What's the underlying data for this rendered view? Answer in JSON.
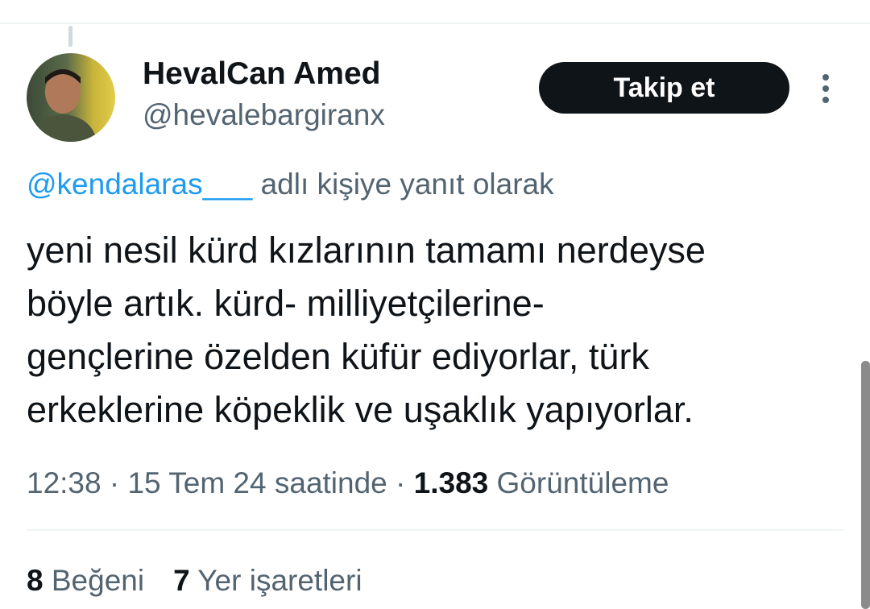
{
  "author": {
    "display_name": "HevalCan Amed",
    "handle": "@hevalebargiranx",
    "avatar_icon": "user-avatar"
  },
  "follow_button": {
    "label": "Takip et"
  },
  "more_icon": "more-vertical-icon",
  "reply": {
    "mention": "@kendalaras___",
    "suffix": " adlı kişiye yanıt olarak"
  },
  "tweet": {
    "lines": [
      "yeni nesil kürd kızlarının tamamı nerdeyse",
      "böyle artık. kürd- milliyetçilerine-",
      "gençlerine özelden küfür ediyorlar, türk",
      "erkeklerine köpeklik ve uşaklık yapıyorlar."
    ]
  },
  "meta": {
    "time": "12:38",
    "separator": " · ",
    "date": "15 Tem 24 saatinde",
    "views_count": "1.383",
    "views_label": " Görüntüleme"
  },
  "stats": {
    "likes_count": "8",
    "likes_label": " Beğeni",
    "bookmarks_count": "7",
    "bookmarks_label": " Yer işaretleri"
  },
  "colors": {
    "link": "#1d9bf0",
    "secondary_text": "#536471",
    "primary_text": "#0f1419",
    "button_bg": "#0f1419"
  }
}
